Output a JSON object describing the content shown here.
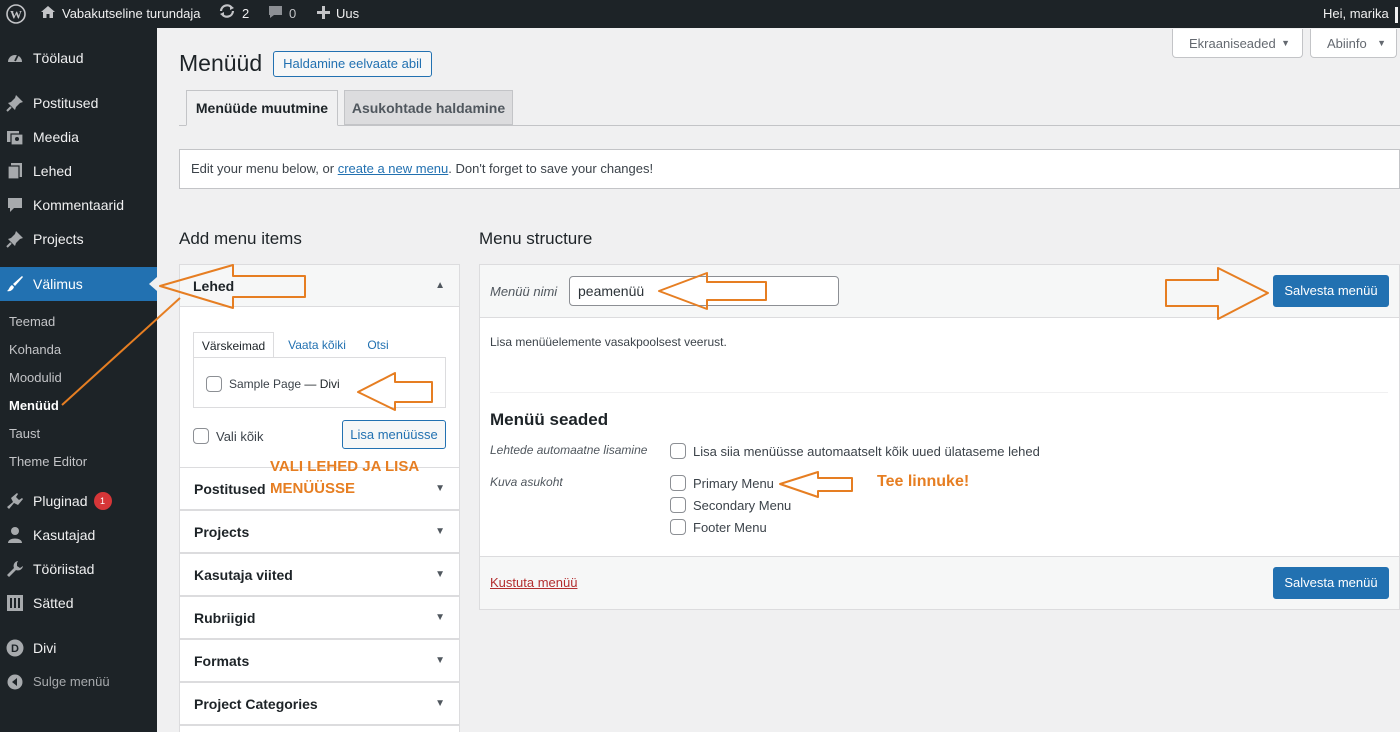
{
  "admin_bar": {
    "site_name": "Vabakutseline turundaja",
    "updates_count": "2",
    "comments_count": "0",
    "new_label": "Uus",
    "greeting": "Hei, marika"
  },
  "sidebar": {
    "items": [
      {
        "label": "Töölaud"
      },
      {
        "label": "Postitused"
      },
      {
        "label": "Meedia"
      },
      {
        "label": "Lehed"
      },
      {
        "label": "Kommentaarid"
      },
      {
        "label": "Projects"
      },
      {
        "label": "Välimus"
      }
    ],
    "submenu": [
      {
        "label": "Teemad"
      },
      {
        "label": "Kohanda"
      },
      {
        "label": "Moodulid"
      },
      {
        "label": "Menüüd"
      },
      {
        "label": "Taust"
      },
      {
        "label": "Theme Editor"
      }
    ],
    "items2": [
      {
        "label": "Pluginad"
      },
      {
        "label": "Kasutajad"
      },
      {
        "label": "Tööriistad"
      },
      {
        "label": "Sätted"
      },
      {
        "label": "Divi"
      },
      {
        "label": "Sulge menüü"
      }
    ],
    "plugins_badge": "1"
  },
  "header": {
    "title": "Menüüd",
    "preview_button": "Haldamine eelvaate abil",
    "screen_options": "Ekraaniseaded",
    "help": "Abiinfo"
  },
  "tabs": [
    {
      "label": "Menüüde muutmine"
    },
    {
      "label": "Asukohtade haldamine"
    }
  ],
  "notice": {
    "before": "Edit your menu below, or ",
    "link": "create a new menu",
    "after": ". Don't forget to save your changes!"
  },
  "add_menu_items": {
    "heading": "Add menu items",
    "pages": {
      "title": "Lehed",
      "tabs": [
        "Värskeimad",
        "Vaata kõiki",
        "Otsi"
      ],
      "item": "Sample Page",
      "item_suffix": "— Divi",
      "select_all": "Vali kõik",
      "add_button": "Lisa menüüsse"
    },
    "sections": [
      "Postitused",
      "Projects",
      "Kasutaja viited",
      "Rubriigid",
      "Formats",
      "Project Categories"
    ]
  },
  "menu_structure": {
    "heading": "Menu structure",
    "name_label": "Menüü nimi",
    "name_value": "peamenüü",
    "save_button": "Salvesta menüü",
    "hint": "Lisa menüüelemente vasakpoolsest veerust.",
    "settings_heading": "Menüü seaded",
    "auto_add_label": "Lehtede automaatne lisamine",
    "auto_add_text": "Lisa siia menüüsse automaatselt kõik uued ülataseme lehed",
    "location_label": "Kuva asukoht",
    "locations": [
      "Primary Menu",
      "Secondary Menu",
      "Footer Menu"
    ],
    "delete_link": "Kustuta menüü"
  },
  "annotations": {
    "select_pages": "VALI LEHED JA LISA MENÜÜSSE",
    "tick": "Tee linnuke!"
  },
  "colors": {
    "accent": "#2271b1",
    "annotation": "#e67e22",
    "admin_dark": "#1d2327"
  }
}
